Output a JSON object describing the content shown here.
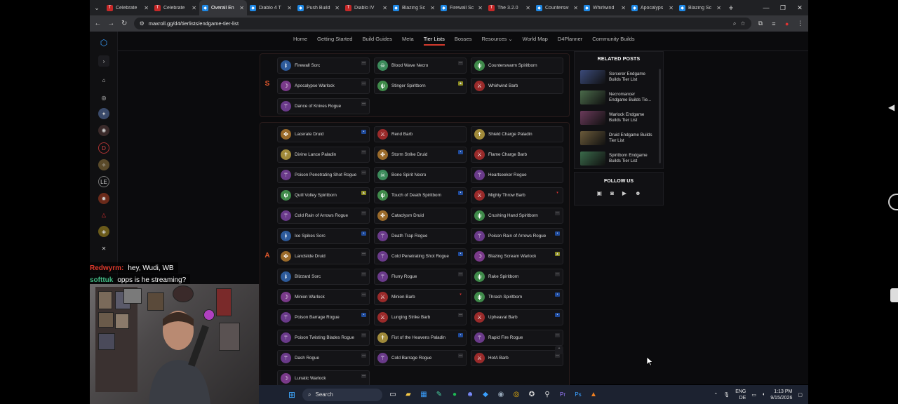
{
  "browser": {
    "tabs": [
      {
        "label": "Celebrate",
        "fav": "T",
        "fav_color": "#c62828",
        "active": false
      },
      {
        "label": "Celebrate",
        "fav": "T",
        "fav_color": "#c62828",
        "active": false
      },
      {
        "label": "Overall En",
        "fav": "◆",
        "fav_color": "#1e88e5",
        "active": true
      },
      {
        "label": "Diablo 4 T",
        "fav": "◆",
        "fav_color": "#1e88e5",
        "active": false
      },
      {
        "label": "Push Build",
        "fav": "◆",
        "fav_color": "#1e88e5",
        "active": false
      },
      {
        "label": "Diablo IV",
        "fav": "T",
        "fav_color": "#c62828",
        "active": false
      },
      {
        "label": "Blazing Sc",
        "fav": "◆",
        "fav_color": "#1e88e5",
        "active": false
      },
      {
        "label": "Firewall Sc",
        "fav": "◆",
        "fav_color": "#1e88e5",
        "active": false
      },
      {
        "label": "The 3.2.0",
        "fav": "T",
        "fav_color": "#c62828",
        "active": false
      },
      {
        "label": "Countersw",
        "fav": "◆",
        "fav_color": "#1e88e5",
        "active": false
      },
      {
        "label": "Whirlwind",
        "fav": "◆",
        "fav_color": "#1e88e5",
        "active": false
      },
      {
        "label": "Apocalyps",
        "fav": "◆",
        "fav_color": "#1e88e5",
        "active": false
      },
      {
        "label": "Blazing Sc",
        "fav": "◆",
        "fav_color": "#1e88e5",
        "active": false
      }
    ],
    "url": "maxroll.gg/d4/tierlists/endgame-tier-list"
  },
  "nav": [
    "Home",
    "Getting Started",
    "Build Guides",
    "Meta",
    "Tier Lists",
    "Bosses",
    "Resources ⌄",
    "World Map",
    "D4Planner",
    "Community Builds"
  ],
  "tiers": {
    "s": {
      "label": "S",
      "entries": [
        {
          "name": "Firewall Sorc",
          "cls": "sorc",
          "trend": "flat"
        },
        {
          "name": "Blood Wave Necro",
          "cls": "necro",
          "trend": "flat"
        },
        {
          "name": "Counterswarm Spiritborn",
          "cls": "spirit",
          "trend": "none"
        },
        {
          "name": "Apocalypse Warlock",
          "cls": "warlock",
          "trend": "flat"
        },
        {
          "name": "Stinger Spiritborn",
          "cls": "spirit",
          "trend": "up"
        },
        {
          "name": "Whirlwind Barb",
          "cls": "barb",
          "trend": "none"
        },
        {
          "name": "Dance of Knives Rogue",
          "cls": "rogue",
          "trend": "flat"
        }
      ]
    },
    "a": {
      "label": "A",
      "entries": [
        {
          "name": "Lacerate Druid",
          "cls": "druid",
          "trend": "new"
        },
        {
          "name": "Rend Barb",
          "cls": "barb",
          "trend": "none"
        },
        {
          "name": "Shield Charge Paladin",
          "cls": "paladin",
          "trend": "none"
        },
        {
          "name": "Divine Lance Paladin",
          "cls": "paladin",
          "trend": "flat"
        },
        {
          "name": "Storm Strike Druid",
          "cls": "druid",
          "trend": "new"
        },
        {
          "name": "Flame Charge Barb",
          "cls": "barb",
          "trend": "none"
        },
        {
          "name": "Poison Penetrating Shot Rogue",
          "cls": "rogue",
          "trend": "flat"
        },
        {
          "name": "Bone Spirit Necro",
          "cls": "necro",
          "trend": "none"
        },
        {
          "name": "Heartseeker Rogue",
          "cls": "rogue",
          "trend": "none"
        },
        {
          "name": "Quill Volley Spiritborn",
          "cls": "spirit",
          "trend": "up"
        },
        {
          "name": "Touch of Death Spiritborn",
          "cls": "spirit",
          "trend": "new"
        },
        {
          "name": "Mighty Throw Barb",
          "cls": "barb",
          "trend": "down"
        },
        {
          "name": "Cold Rain of Arrows Rogue",
          "cls": "rogue",
          "trend": "flat"
        },
        {
          "name": "Cataclysm Druid",
          "cls": "druid",
          "trend": "none"
        },
        {
          "name": "Crushing Hand Spiritborn",
          "cls": "spirit",
          "trend": "flat"
        },
        {
          "name": "Ice Spikes Sorc",
          "cls": "sorc",
          "trend": "new"
        },
        {
          "name": "Death Trap Rogue",
          "cls": "rogue",
          "trend": "none"
        },
        {
          "name": "Poison Rain of Arrows Rogue",
          "cls": "rogue",
          "trend": "new"
        },
        {
          "name": "Landslide Druid",
          "cls": "druid",
          "trend": "flat"
        },
        {
          "name": "Cold Penetrating Shot Rogue",
          "cls": "rogue",
          "trend": "new"
        },
        {
          "name": "Blazing Scream Warlock",
          "cls": "warlock",
          "trend": "up"
        },
        {
          "name": "Blizzard Sorc",
          "cls": "sorc",
          "trend": "flat"
        },
        {
          "name": "Flurry Rogue",
          "cls": "rogue",
          "trend": "flat"
        },
        {
          "name": "Rake Spiritborn",
          "cls": "spirit",
          "trend": "flat"
        },
        {
          "name": "Minion Warlock",
          "cls": "warlock",
          "trend": "flat"
        },
        {
          "name": "Minion Barb",
          "cls": "barb",
          "trend": "down"
        },
        {
          "name": "Thrash Spiritborn",
          "cls": "spirit",
          "trend": "new"
        },
        {
          "name": "Poison Barrage Rogue",
          "cls": "rogue",
          "trend": "new"
        },
        {
          "name": "Lunging Strike Barb",
          "cls": "barb",
          "trend": "flat"
        },
        {
          "name": "Upheaval Barb",
          "cls": "barb",
          "trend": "new"
        },
        {
          "name": "Poison Twisting Blades Rogue",
          "cls": "rogue",
          "trend": "flat"
        },
        {
          "name": "Fist of the Heavens Paladin",
          "cls": "paladin",
          "trend": "new"
        },
        {
          "name": "Rapid Fire Rogue",
          "cls": "rogue",
          "trend": "flat"
        },
        {
          "name": "Dash Rogue",
          "cls": "rogue",
          "trend": "flat"
        },
        {
          "name": "Cold Barrage Rogue",
          "cls": "rogue",
          "trend": "flat"
        },
        {
          "name": "HotA Barb",
          "cls": "barb",
          "trend": "flat"
        },
        {
          "name": "Lunatic Warlock",
          "cls": "warlock",
          "trend": "flat"
        }
      ]
    }
  },
  "related": {
    "title": "RELATED POSTS",
    "posts": [
      {
        "title": "Sorcerer Endgame Builds Tier List",
        "line1": "Sorcerer Endgame",
        "line2": "Builds Tier List",
        "color": "#3b4a7a"
      },
      {
        "title": "Necromancer Endgame Builds Tie...",
        "line1": "Necromancer",
        "line2": "Endgame Builds Tie...",
        "color": "#4a6a4a"
      },
      {
        "title": "Warlock Endgame Builds Tier List",
        "line1": "Warlock Endgame",
        "line2": "Builds Tier List",
        "color": "#6a3a5a"
      },
      {
        "title": "Druid Endgame Builds Tier List",
        "line1": "Druid Endgame Builds",
        "line2": "Tier List",
        "color": "#6a5a3a"
      },
      {
        "title": "Spiritborn Endgame Builds Tier List",
        "line1": "Spiritborn Endgame",
        "line2": "Builds Tier List",
        "color": "#3a6a4a"
      }
    ]
  },
  "follow": {
    "title": "FOLLOW US",
    "icons": [
      "twitch-icon",
      "instagram-icon",
      "youtube-icon",
      "discord-icon"
    ]
  },
  "chat": [
    {
      "user": "Redwyrm:",
      "msg": "hey, Wudi, WB",
      "color": "red"
    },
    {
      "user": "softtuk",
      "msg": "opps is he streaming?",
      "color": "green"
    }
  ],
  "taskbar": {
    "search": "Search",
    "lang1": "ENG",
    "lang2": "DE",
    "time": "1:13 PM",
    "date": "9/15/2026"
  },
  "colors": {
    "sorc": "#2d5a9a",
    "necro": "#3b8a5a",
    "spirit": "#3f8a4a",
    "warlock": "#7a3a8a",
    "barb": "#9a2a2a",
    "rogue": "#6a3a8a",
    "druid": "#9a6a2a",
    "paladin": "#a08a3a",
    "accent": "#d53a2d"
  }
}
